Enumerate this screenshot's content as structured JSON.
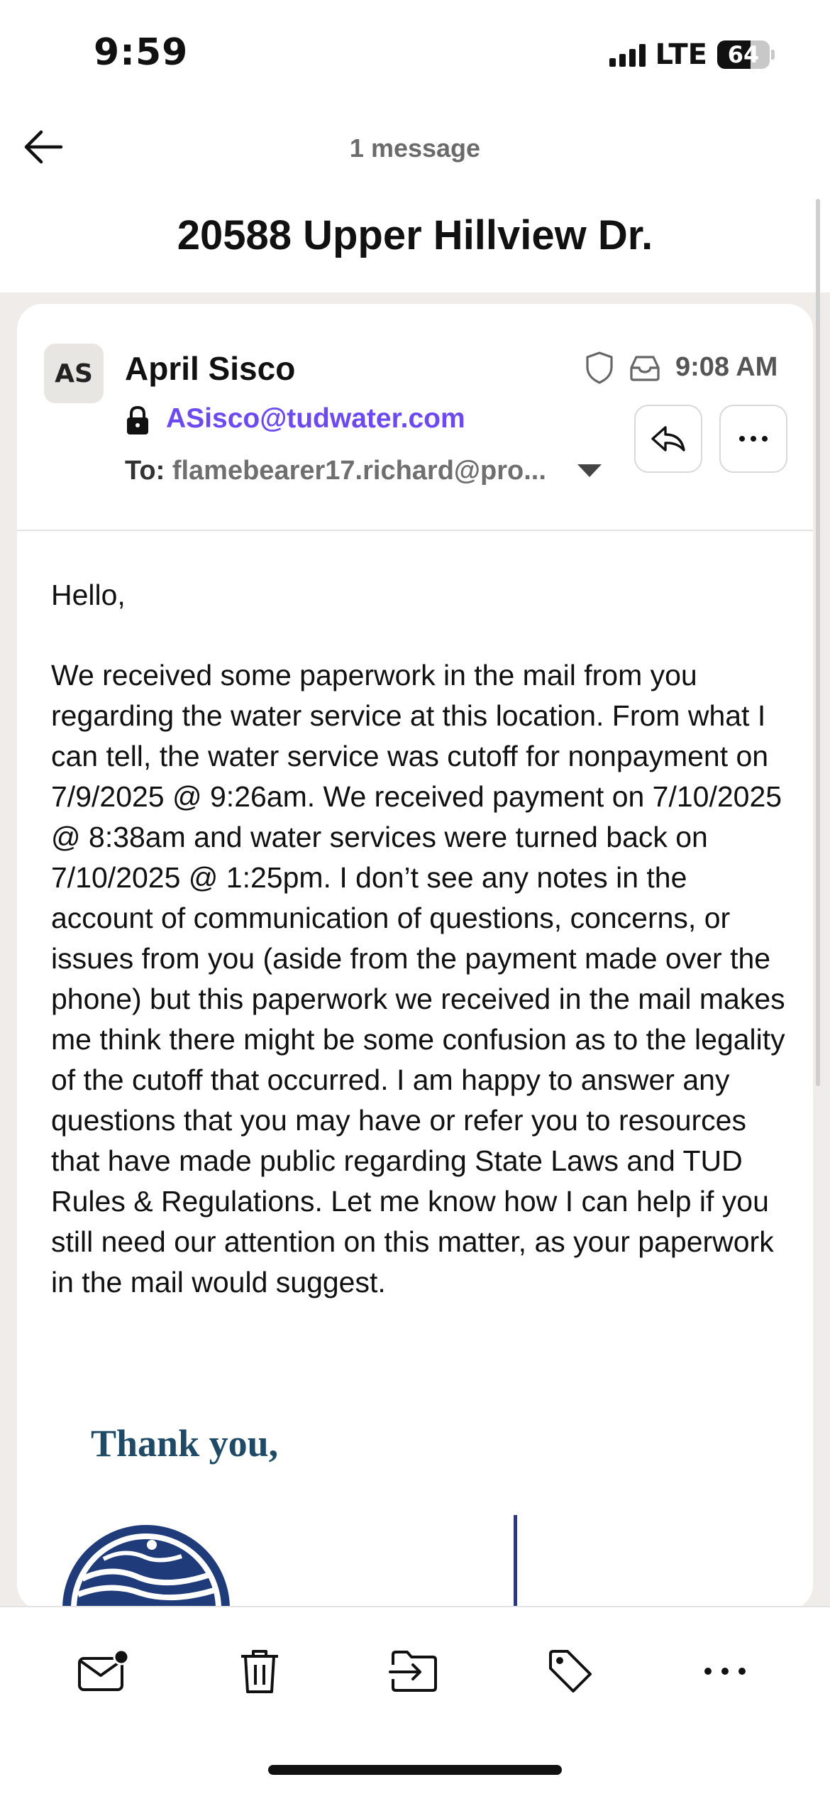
{
  "status_bar": {
    "time": "9:59",
    "network": "LTE",
    "battery": "64",
    "battery_level": 0.64
  },
  "nav": {
    "message_count": "1 message",
    "subject": "20588 Upper Hillview Dr."
  },
  "message": {
    "avatar_initials": "AS",
    "sender_name": "April Sisco",
    "sender_email": "ASisco@tudwater.com",
    "to_label": "To:",
    "to_address": "flamebearer17.richard@pro...",
    "time": "9:08 AM",
    "greeting": "Hello,",
    "body": "We received some paperwork in the mail from you regarding the water service at this location. From what I can tell, the water service was cutoff for nonpayment on 7/9/2025 @ 9:26am. We received payment on 7/10/2025 @ 8:38am and water services were turned back on 7/10/2025 @ 1:25pm. I don’t see any notes in the account of communication of questions, concerns, or issues from you (aside from the payment made over the phone) but this paperwork we received in the mail makes me think there might be some confusion as to the legality of the cutoff that occurred. I am happy to answer any questions that you may have or refer you to resources that have made public regarding State Laws and TUD Rules & Regulations. Let me know how I can help if you still need our attention on this matter, as your paperwork in the mail would suggest.",
    "signature_thanks": "Thank you,"
  },
  "icons": {
    "back": "arrow-left-icon",
    "lock": "lock-icon",
    "shield": "shield-icon",
    "inbox": "inbox-tray-icon",
    "reply": "reply-icon",
    "more": "more-horizontal-icon",
    "toolbar": [
      "mail-unread-icon",
      "trash-icon",
      "move-to-folder-icon",
      "tag-icon",
      "more-horizontal-icon"
    ]
  },
  "colors": {
    "accent": "#6d4af0",
    "signature": "#1e4a66",
    "background_gray": "#efece9"
  }
}
